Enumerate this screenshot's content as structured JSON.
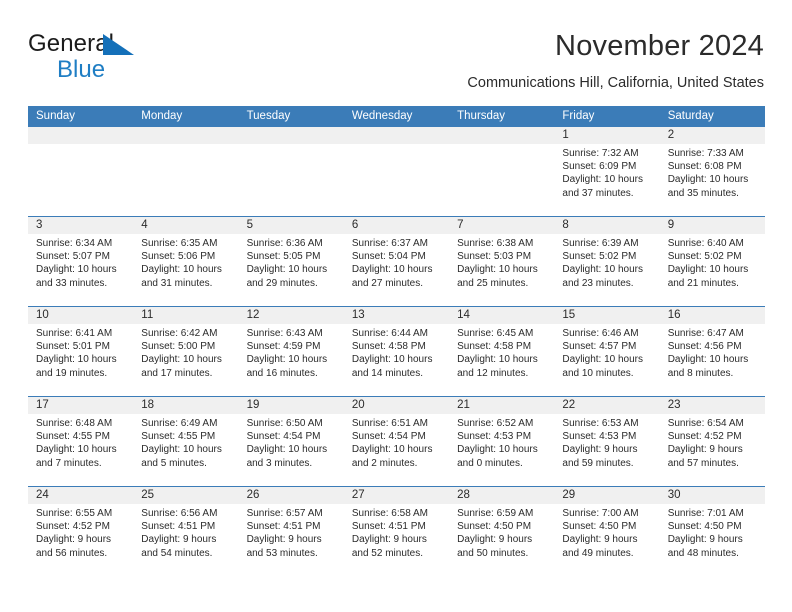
{
  "brand": {
    "name_part1": "General",
    "name_part2": "Blue",
    "triangle_color": "#1470b9",
    "blue_color": "#1f7ec4"
  },
  "header": {
    "title": "November 2024",
    "subtitle": "Communications Hill, California, United States"
  },
  "theme": {
    "header_row_bg": "#3b7cb8",
    "date_strip_bg": "#f0f0f0",
    "text_color": "#2b2b2b",
    "cell_bg": "#ffffff"
  },
  "calendar": {
    "weekday_headers": [
      "Sunday",
      "Monday",
      "Tuesday",
      "Wednesday",
      "Thursday",
      "Friday",
      "Saturday"
    ],
    "weeks": [
      [
        {
          "day": "",
          "sunrise": "",
          "sunset": "",
          "daylight1": "",
          "daylight2": ""
        },
        {
          "day": "",
          "sunrise": "",
          "sunset": "",
          "daylight1": "",
          "daylight2": ""
        },
        {
          "day": "",
          "sunrise": "",
          "sunset": "",
          "daylight1": "",
          "daylight2": ""
        },
        {
          "day": "",
          "sunrise": "",
          "sunset": "",
          "daylight1": "",
          "daylight2": ""
        },
        {
          "day": "",
          "sunrise": "",
          "sunset": "",
          "daylight1": "",
          "daylight2": ""
        },
        {
          "day": "1",
          "sunrise": "Sunrise: 7:32 AM",
          "sunset": "Sunset: 6:09 PM",
          "daylight1": "Daylight: 10 hours",
          "daylight2": "and 37 minutes."
        },
        {
          "day": "2",
          "sunrise": "Sunrise: 7:33 AM",
          "sunset": "Sunset: 6:08 PM",
          "daylight1": "Daylight: 10 hours",
          "daylight2": "and 35 minutes."
        }
      ],
      [
        {
          "day": "3",
          "sunrise": "Sunrise: 6:34 AM",
          "sunset": "Sunset: 5:07 PM",
          "daylight1": "Daylight: 10 hours",
          "daylight2": "and 33 minutes."
        },
        {
          "day": "4",
          "sunrise": "Sunrise: 6:35 AM",
          "sunset": "Sunset: 5:06 PM",
          "daylight1": "Daylight: 10 hours",
          "daylight2": "and 31 minutes."
        },
        {
          "day": "5",
          "sunrise": "Sunrise: 6:36 AM",
          "sunset": "Sunset: 5:05 PM",
          "daylight1": "Daylight: 10 hours",
          "daylight2": "and 29 minutes."
        },
        {
          "day": "6",
          "sunrise": "Sunrise: 6:37 AM",
          "sunset": "Sunset: 5:04 PM",
          "daylight1": "Daylight: 10 hours",
          "daylight2": "and 27 minutes."
        },
        {
          "day": "7",
          "sunrise": "Sunrise: 6:38 AM",
          "sunset": "Sunset: 5:03 PM",
          "daylight1": "Daylight: 10 hours",
          "daylight2": "and 25 minutes."
        },
        {
          "day": "8",
          "sunrise": "Sunrise: 6:39 AM",
          "sunset": "Sunset: 5:02 PM",
          "daylight1": "Daylight: 10 hours",
          "daylight2": "and 23 minutes."
        },
        {
          "day": "9",
          "sunrise": "Sunrise: 6:40 AM",
          "sunset": "Sunset: 5:02 PM",
          "daylight1": "Daylight: 10 hours",
          "daylight2": "and 21 minutes."
        }
      ],
      [
        {
          "day": "10",
          "sunrise": "Sunrise: 6:41 AM",
          "sunset": "Sunset: 5:01 PM",
          "daylight1": "Daylight: 10 hours",
          "daylight2": "and 19 minutes."
        },
        {
          "day": "11",
          "sunrise": "Sunrise: 6:42 AM",
          "sunset": "Sunset: 5:00 PM",
          "daylight1": "Daylight: 10 hours",
          "daylight2": "and 17 minutes."
        },
        {
          "day": "12",
          "sunrise": "Sunrise: 6:43 AM",
          "sunset": "Sunset: 4:59 PM",
          "daylight1": "Daylight: 10 hours",
          "daylight2": "and 16 minutes."
        },
        {
          "day": "13",
          "sunrise": "Sunrise: 6:44 AM",
          "sunset": "Sunset: 4:58 PM",
          "daylight1": "Daylight: 10 hours",
          "daylight2": "and 14 minutes."
        },
        {
          "day": "14",
          "sunrise": "Sunrise: 6:45 AM",
          "sunset": "Sunset: 4:58 PM",
          "daylight1": "Daylight: 10 hours",
          "daylight2": "and 12 minutes."
        },
        {
          "day": "15",
          "sunrise": "Sunrise: 6:46 AM",
          "sunset": "Sunset: 4:57 PM",
          "daylight1": "Daylight: 10 hours",
          "daylight2": "and 10 minutes."
        },
        {
          "day": "16",
          "sunrise": "Sunrise: 6:47 AM",
          "sunset": "Sunset: 4:56 PM",
          "daylight1": "Daylight: 10 hours",
          "daylight2": "and 8 minutes."
        }
      ],
      [
        {
          "day": "17",
          "sunrise": "Sunrise: 6:48 AM",
          "sunset": "Sunset: 4:55 PM",
          "daylight1": "Daylight: 10 hours",
          "daylight2": "and 7 minutes."
        },
        {
          "day": "18",
          "sunrise": "Sunrise: 6:49 AM",
          "sunset": "Sunset: 4:55 PM",
          "daylight1": "Daylight: 10 hours",
          "daylight2": "and 5 minutes."
        },
        {
          "day": "19",
          "sunrise": "Sunrise: 6:50 AM",
          "sunset": "Sunset: 4:54 PM",
          "daylight1": "Daylight: 10 hours",
          "daylight2": "and 3 minutes."
        },
        {
          "day": "20",
          "sunrise": "Sunrise: 6:51 AM",
          "sunset": "Sunset: 4:54 PM",
          "daylight1": "Daylight: 10 hours",
          "daylight2": "and 2 minutes."
        },
        {
          "day": "21",
          "sunrise": "Sunrise: 6:52 AM",
          "sunset": "Sunset: 4:53 PM",
          "daylight1": "Daylight: 10 hours",
          "daylight2": "and 0 minutes."
        },
        {
          "day": "22",
          "sunrise": "Sunrise: 6:53 AM",
          "sunset": "Sunset: 4:53 PM",
          "daylight1": "Daylight: 9 hours",
          "daylight2": "and 59 minutes."
        },
        {
          "day": "23",
          "sunrise": "Sunrise: 6:54 AM",
          "sunset": "Sunset: 4:52 PM",
          "daylight1": "Daylight: 9 hours",
          "daylight2": "and 57 minutes."
        }
      ],
      [
        {
          "day": "24",
          "sunrise": "Sunrise: 6:55 AM",
          "sunset": "Sunset: 4:52 PM",
          "daylight1": "Daylight: 9 hours",
          "daylight2": "and 56 minutes."
        },
        {
          "day": "25",
          "sunrise": "Sunrise: 6:56 AM",
          "sunset": "Sunset: 4:51 PM",
          "daylight1": "Daylight: 9 hours",
          "daylight2": "and 54 minutes."
        },
        {
          "day": "26",
          "sunrise": "Sunrise: 6:57 AM",
          "sunset": "Sunset: 4:51 PM",
          "daylight1": "Daylight: 9 hours",
          "daylight2": "and 53 minutes."
        },
        {
          "day": "27",
          "sunrise": "Sunrise: 6:58 AM",
          "sunset": "Sunset: 4:51 PM",
          "daylight1": "Daylight: 9 hours",
          "daylight2": "and 52 minutes."
        },
        {
          "day": "28",
          "sunrise": "Sunrise: 6:59 AM",
          "sunset": "Sunset: 4:50 PM",
          "daylight1": "Daylight: 9 hours",
          "daylight2": "and 50 minutes."
        },
        {
          "day": "29",
          "sunrise": "Sunrise: 7:00 AM",
          "sunset": "Sunset: 4:50 PM",
          "daylight1": "Daylight: 9 hours",
          "daylight2": "and 49 minutes."
        },
        {
          "day": "30",
          "sunrise": "Sunrise: 7:01 AM",
          "sunset": "Sunset: 4:50 PM",
          "daylight1": "Daylight: 9 hours",
          "daylight2": "and 48 minutes."
        }
      ]
    ]
  }
}
